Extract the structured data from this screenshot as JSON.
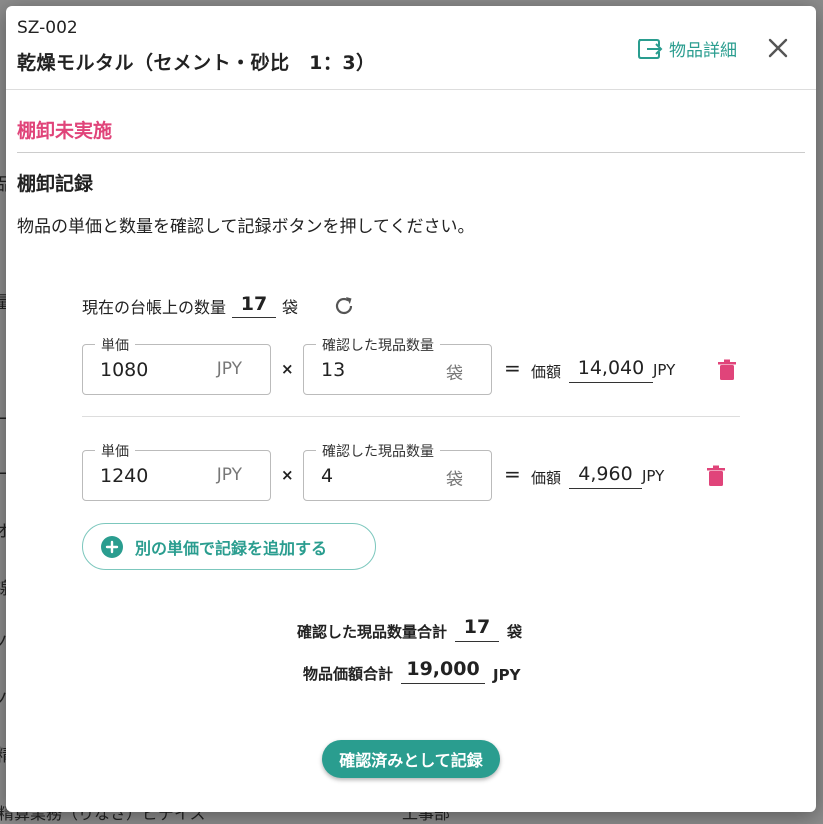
{
  "background": {
    "fragments": [
      "品",
      "量",
      "ー",
      "ー",
      "オ",
      "線",
      "ノ",
      "ノ",
      "精",
      "精算業務（りなさ）ビデイス",
      "工事部"
    ]
  },
  "header": {
    "code": "SZ-002",
    "title": "乾燥モルタル（セメント・砂比　1：3）",
    "detail_link": "物品詳細"
  },
  "status": "棚卸未実施",
  "section_title": "棚卸記録",
  "instruction": "物品の単価と数量を確認して記録ボタンを押してください。",
  "ledger": {
    "label": "現在の台帳上の数量",
    "quantity": "17",
    "unit": "袋"
  },
  "records": [
    {
      "unit_price_label": "単価",
      "unit_price": "1080",
      "currency": "JPY",
      "times": "×",
      "qty_label": "確認した現品数量",
      "qty": "13",
      "qty_unit": "袋",
      "equals": "=",
      "price_label": "価額",
      "price": "14,040",
      "price_currency": "JPY"
    },
    {
      "unit_price_label": "単価",
      "unit_price": "1240",
      "currency": "JPY",
      "times": "×",
      "qty_label": "確認した現品数量",
      "qty": "4",
      "qty_unit": "袋",
      "equals": "=",
      "price_label": "価額",
      "price": "4,960",
      "price_currency": "JPY"
    }
  ],
  "add_button": "別の単価で記録を追加する",
  "totals": {
    "qty_label": "確認した現品数量合計",
    "qty": "17",
    "qty_unit": "袋",
    "value_label": "物品価額合計",
    "value": "19,000",
    "value_unit": "JPY"
  },
  "submit_button": "確認済みとして記録",
  "colors": {
    "accent": "#2a9d8f",
    "status": "#e0447a",
    "delete": "#e0447a"
  }
}
